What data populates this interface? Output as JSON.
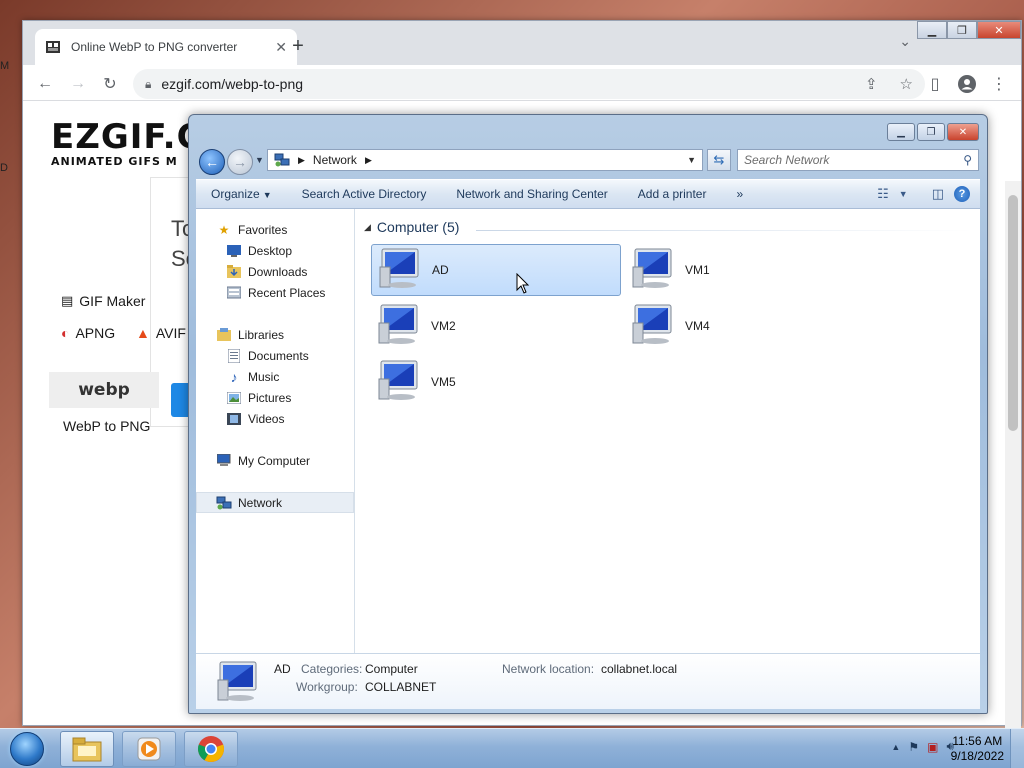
{
  "desktop": {
    "left_letter_1": "M",
    "left_letter_2": "D"
  },
  "browser": {
    "tab_title": "Online WebP to PNG converter",
    "tab_close": "✕",
    "new_tab": "+",
    "url": "ezgif.com/webp-to-png",
    "page": {
      "logo_big": "EZGIF.C",
      "logo_small": "ANIMATED GIFS M",
      "card_title_1": "To",
      "card_title_2": "Se",
      "nav_gif_maker": "GIF Maker",
      "nav_apng": "APNG",
      "nav_avif": "AVIF",
      "webp_logo": "webp",
      "webp_label": "WebP to PNG"
    }
  },
  "explorer": {
    "address": {
      "root_icon": "network-icon",
      "crumb": "Network"
    },
    "search": {
      "placeholder": "Search Network"
    },
    "commands": {
      "organize": "Organize",
      "search_ad": "Search Active Directory",
      "network_sharing": "Network and Sharing Center",
      "add_printer": "Add a printer",
      "more": "»"
    },
    "nav": {
      "favorites": "Favorites",
      "desktop": "Desktop",
      "downloads": "Downloads",
      "recent_places": "Recent Places",
      "libraries": "Libraries",
      "documents": "Documents",
      "music": "Music",
      "pictures": "Pictures",
      "videos": "Videos",
      "my_computer": "My Computer",
      "network": "Network"
    },
    "group_header": "Computer (5)",
    "computers": [
      "AD",
      "VM1",
      "VM2",
      "VM4",
      "VM5"
    ],
    "details": {
      "name": "AD",
      "categories_label": "Categories:",
      "categories_value": "Computer",
      "workgroup_label": "Workgroup:",
      "workgroup_value": "COLLABNET",
      "location_label": "Network location:",
      "location_value": "collabnet.local"
    }
  },
  "taskbar": {
    "time": "11:56 AM",
    "date": "9/18/2022"
  },
  "colors": {
    "selection_bg": "#c1dcfc",
    "command_text": "#1e395b",
    "taskbar": "#8fb1d8"
  }
}
